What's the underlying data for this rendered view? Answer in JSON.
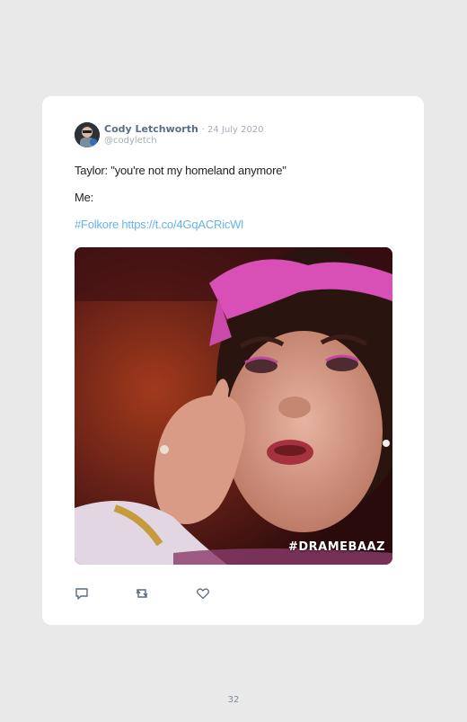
{
  "tweet": {
    "author_name": "Cody Letchworth",
    "date": "· 24 July 2020",
    "handle": "@codyletch",
    "line1": "Taylor: \"you're not my homeland anymore\"",
    "line2": "Me:",
    "line3": "#Folkore https://t.co/4GqACRicWl",
    "media_watermark": "#DRAMEBAAZ",
    "link_color": "#66b3e8",
    "author_color": "#5a6e86"
  },
  "actions": {
    "reply_icon": "reply-icon",
    "retweet_icon": "retweet-icon",
    "like_icon": "heart-icon"
  },
  "footer": {
    "page_number": "32"
  }
}
